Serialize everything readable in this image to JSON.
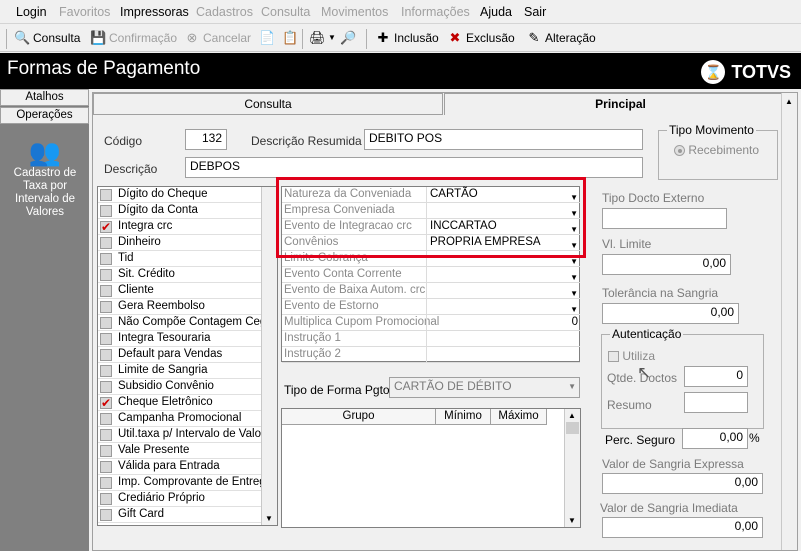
{
  "menu": {
    "items": [
      {
        "label": "Login",
        "enabled": true
      },
      {
        "label": "Favoritos",
        "enabled": false
      },
      {
        "label": "Impressoras",
        "enabled": true
      },
      {
        "label": "Cadastros",
        "enabled": false
      },
      {
        "label": "Consulta",
        "enabled": false
      },
      {
        "label": "Movimentos",
        "enabled": false
      },
      {
        "label": "Informações",
        "enabled": false
      },
      {
        "label": "Ajuda",
        "enabled": true
      },
      {
        "label": "Sair",
        "enabled": true
      }
    ]
  },
  "toolbar": {
    "consulta": "Consulta",
    "confirmacao": "Confirmação",
    "cancelar": "Cancelar",
    "inclusao": "Inclusão",
    "exclusao": "Exclusão",
    "alteracao": "Alteração"
  },
  "header": {
    "title": "Formas de Pagamento",
    "brand": "TOTVS"
  },
  "left": {
    "tabs": [
      "Atalhos",
      "Operações"
    ],
    "shortcut_label": "Cadastro de Taxa por Intervalo de Valores"
  },
  "tabs": [
    "Consulta",
    "Principal"
  ],
  "form": {
    "codigo_label": "Código",
    "codigo_value": "132",
    "desc_resumida_label": "Descrição Resumida",
    "desc_resumida_value": "DEBITO POS",
    "descricao_label": "Descrição",
    "descricao_value": "DEBPOS",
    "tipo_mov_title": "Tipo Movimento",
    "tipo_mov_option": "Recebimento"
  },
  "checklist": [
    {
      "label": "Dígito do Cheque",
      "checked": false
    },
    {
      "label": "Dígito da Conta",
      "checked": false
    },
    {
      "label": "Integra crc",
      "checked": true
    },
    {
      "label": "Dinheiro",
      "checked": false
    },
    {
      "label": "Tid",
      "checked": false
    },
    {
      "label": "Sit. Crédito",
      "checked": false
    },
    {
      "label": "Cliente",
      "checked": false
    },
    {
      "label": "Gera Reembolso",
      "checked": false
    },
    {
      "label": "Não Compõe Contagem Cega",
      "checked": false
    },
    {
      "label": "Integra Tesouraria",
      "checked": false
    },
    {
      "label": "Default para Vendas",
      "checked": false
    },
    {
      "label": "Limite de Sangria",
      "checked": false
    },
    {
      "label": "Subsidio Convênio",
      "checked": false
    },
    {
      "label": "Cheque Eletrônico",
      "checked": true
    },
    {
      "label": "Campanha Promocional",
      "checked": false
    },
    {
      "label": "Util.taxa p/ Intervalo de Valor.",
      "checked": false
    },
    {
      "label": "Vale Presente",
      "checked": false
    },
    {
      "label": "Válida para Entrada",
      "checked": false
    },
    {
      "label": "Imp. Comprovante de Entrega",
      "checked": false
    },
    {
      "label": "Crediário Próprio",
      "checked": false
    },
    {
      "label": "Gift Card",
      "checked": false
    }
  ],
  "grid": [
    {
      "label": "Natureza da Conveniada",
      "value": "CARTÃO",
      "dropdown": true
    },
    {
      "label": "Empresa Conveniada",
      "value": "",
      "dropdown": true
    },
    {
      "label": "Evento de Integracao crc",
      "value": "INCCARTAO",
      "dropdown": true
    },
    {
      "label": "Convênios",
      "value": "PROPRIA EMPRESA",
      "dropdown": true
    },
    {
      "label": "Limite Cobrança",
      "value": "",
      "dropdown": true
    },
    {
      "label": "Evento Conta Corrente",
      "value": "",
      "dropdown": true
    },
    {
      "label": "Evento de Baixa Autom. crc",
      "value": "",
      "dropdown": true
    },
    {
      "label": "Evento de Estorno",
      "value": "",
      "dropdown": true
    },
    {
      "label": "Multiplica Cupom Promocional",
      "value": "0",
      "dropdown": false
    },
    {
      "label": "Instrução 1",
      "value": "",
      "dropdown": false
    },
    {
      "label": "Instrução 2",
      "value": "",
      "dropdown": false
    }
  ],
  "tipo_forma": {
    "label": "Tipo de Forma Pgto",
    "value": "CARTÃO DE DÉBITO"
  },
  "grupo_grid": {
    "headers": [
      "Grupo",
      "Mínimo",
      "Máximo"
    ]
  },
  "right": {
    "tipo_docto_label": "Tipo Docto Externo",
    "tipo_docto_value": "",
    "vl_limite_label": "Vl. Limite",
    "vl_limite_value": "0,00",
    "tolerancia_label": "Tolerância na Sangria",
    "tolerancia_value": "0,00",
    "autenticacao_title": "Autenticação",
    "utiliza_label": "Utiliza",
    "qtde_label": "Qtde. Doctos",
    "qtde_value": "0",
    "resumo_label": "Resumo",
    "resumo_value": "",
    "perc_label": "Perc. Seguro",
    "perc_value": "0,00",
    "perc_unit": "%",
    "sangria_expressa_label": "Valor de Sangria Expressa",
    "sangria_expressa_value": "0,00",
    "sangria_imediata_label": "Valor de Sangria Imediata",
    "sangria_imediata_value": "0,00"
  },
  "colors": {
    "highlight": "#e0001a",
    "checkmark": "#d00000",
    "titlebar": "#000000"
  }
}
